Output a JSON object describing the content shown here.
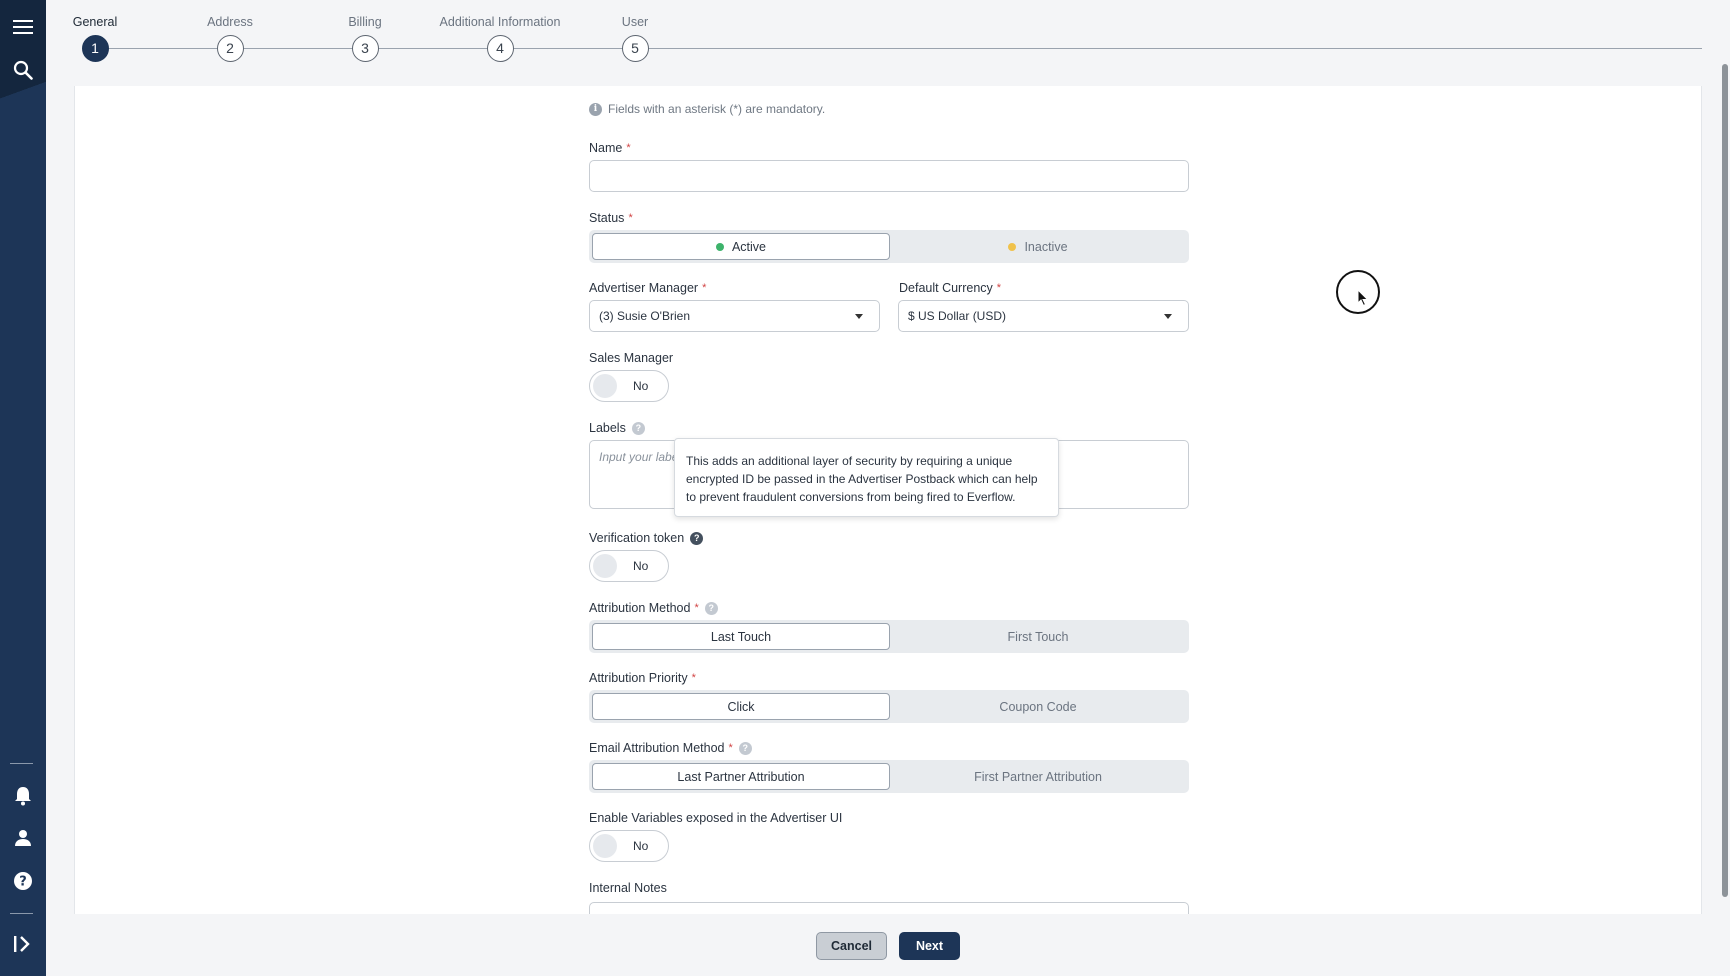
{
  "stepper": {
    "steps": [
      {
        "label": "General",
        "number": "1"
      },
      {
        "label": "Address",
        "number": "2"
      },
      {
        "label": "Billing",
        "number": "3"
      },
      {
        "label": "Additional Information",
        "number": "4"
      },
      {
        "label": "User",
        "number": "5"
      }
    ],
    "active_step": 1
  },
  "form": {
    "mandatory_note": "Fields with an asterisk (*) are mandatory.",
    "required_marker": "*",
    "name": {
      "label": "Name",
      "value": ""
    },
    "status": {
      "label": "Status",
      "options": [
        "Active",
        "Inactive"
      ],
      "selected": "Active"
    },
    "advertiser_manager": {
      "label": "Advertiser Manager",
      "value": "(3) Susie O'Brien"
    },
    "default_currency": {
      "label": "Default Currency",
      "value": "$ US Dollar (USD)"
    },
    "sales_manager": {
      "label": "Sales Manager",
      "value": "No"
    },
    "labels": {
      "label": "Labels",
      "placeholder": "Input your labe"
    },
    "verification_token": {
      "label": "Verification token",
      "value": "No"
    },
    "tooltip": "This adds an additional layer of security by requiring a unique encrypted ID be passed in the Advertiser Postback which can help to prevent fraudulent conversions from being fired to Everflow.",
    "attribution_method": {
      "label": "Attribution Method",
      "options": [
        "Last Touch",
        "First Touch"
      ],
      "selected": "Last Touch"
    },
    "attribution_priority": {
      "label": "Attribution Priority",
      "options": [
        "Click",
        "Coupon Code"
      ],
      "selected": "Click"
    },
    "email_attribution_method": {
      "label": "Email Attribution Method",
      "options": [
        "Last Partner Attribution",
        "First Partner Attribution"
      ],
      "selected": "Last Partner Attribution"
    },
    "enable_variables": {
      "label": "Enable Variables exposed in the Advertiser UI",
      "value": "No"
    },
    "internal_notes": {
      "label": "Internal Notes"
    }
  },
  "footer": {
    "cancel_label": "Cancel",
    "next_label": "Next"
  },
  "colors": {
    "primary": "#1d3557",
    "active_dot": "#3db36b",
    "inactive_dot": "#f0c24b",
    "required": "#d14343"
  },
  "sidebar": {
    "icons": [
      "menu-icon",
      "search-icon",
      "bell-icon",
      "user-icon",
      "help-icon",
      "expand-icon"
    ]
  }
}
